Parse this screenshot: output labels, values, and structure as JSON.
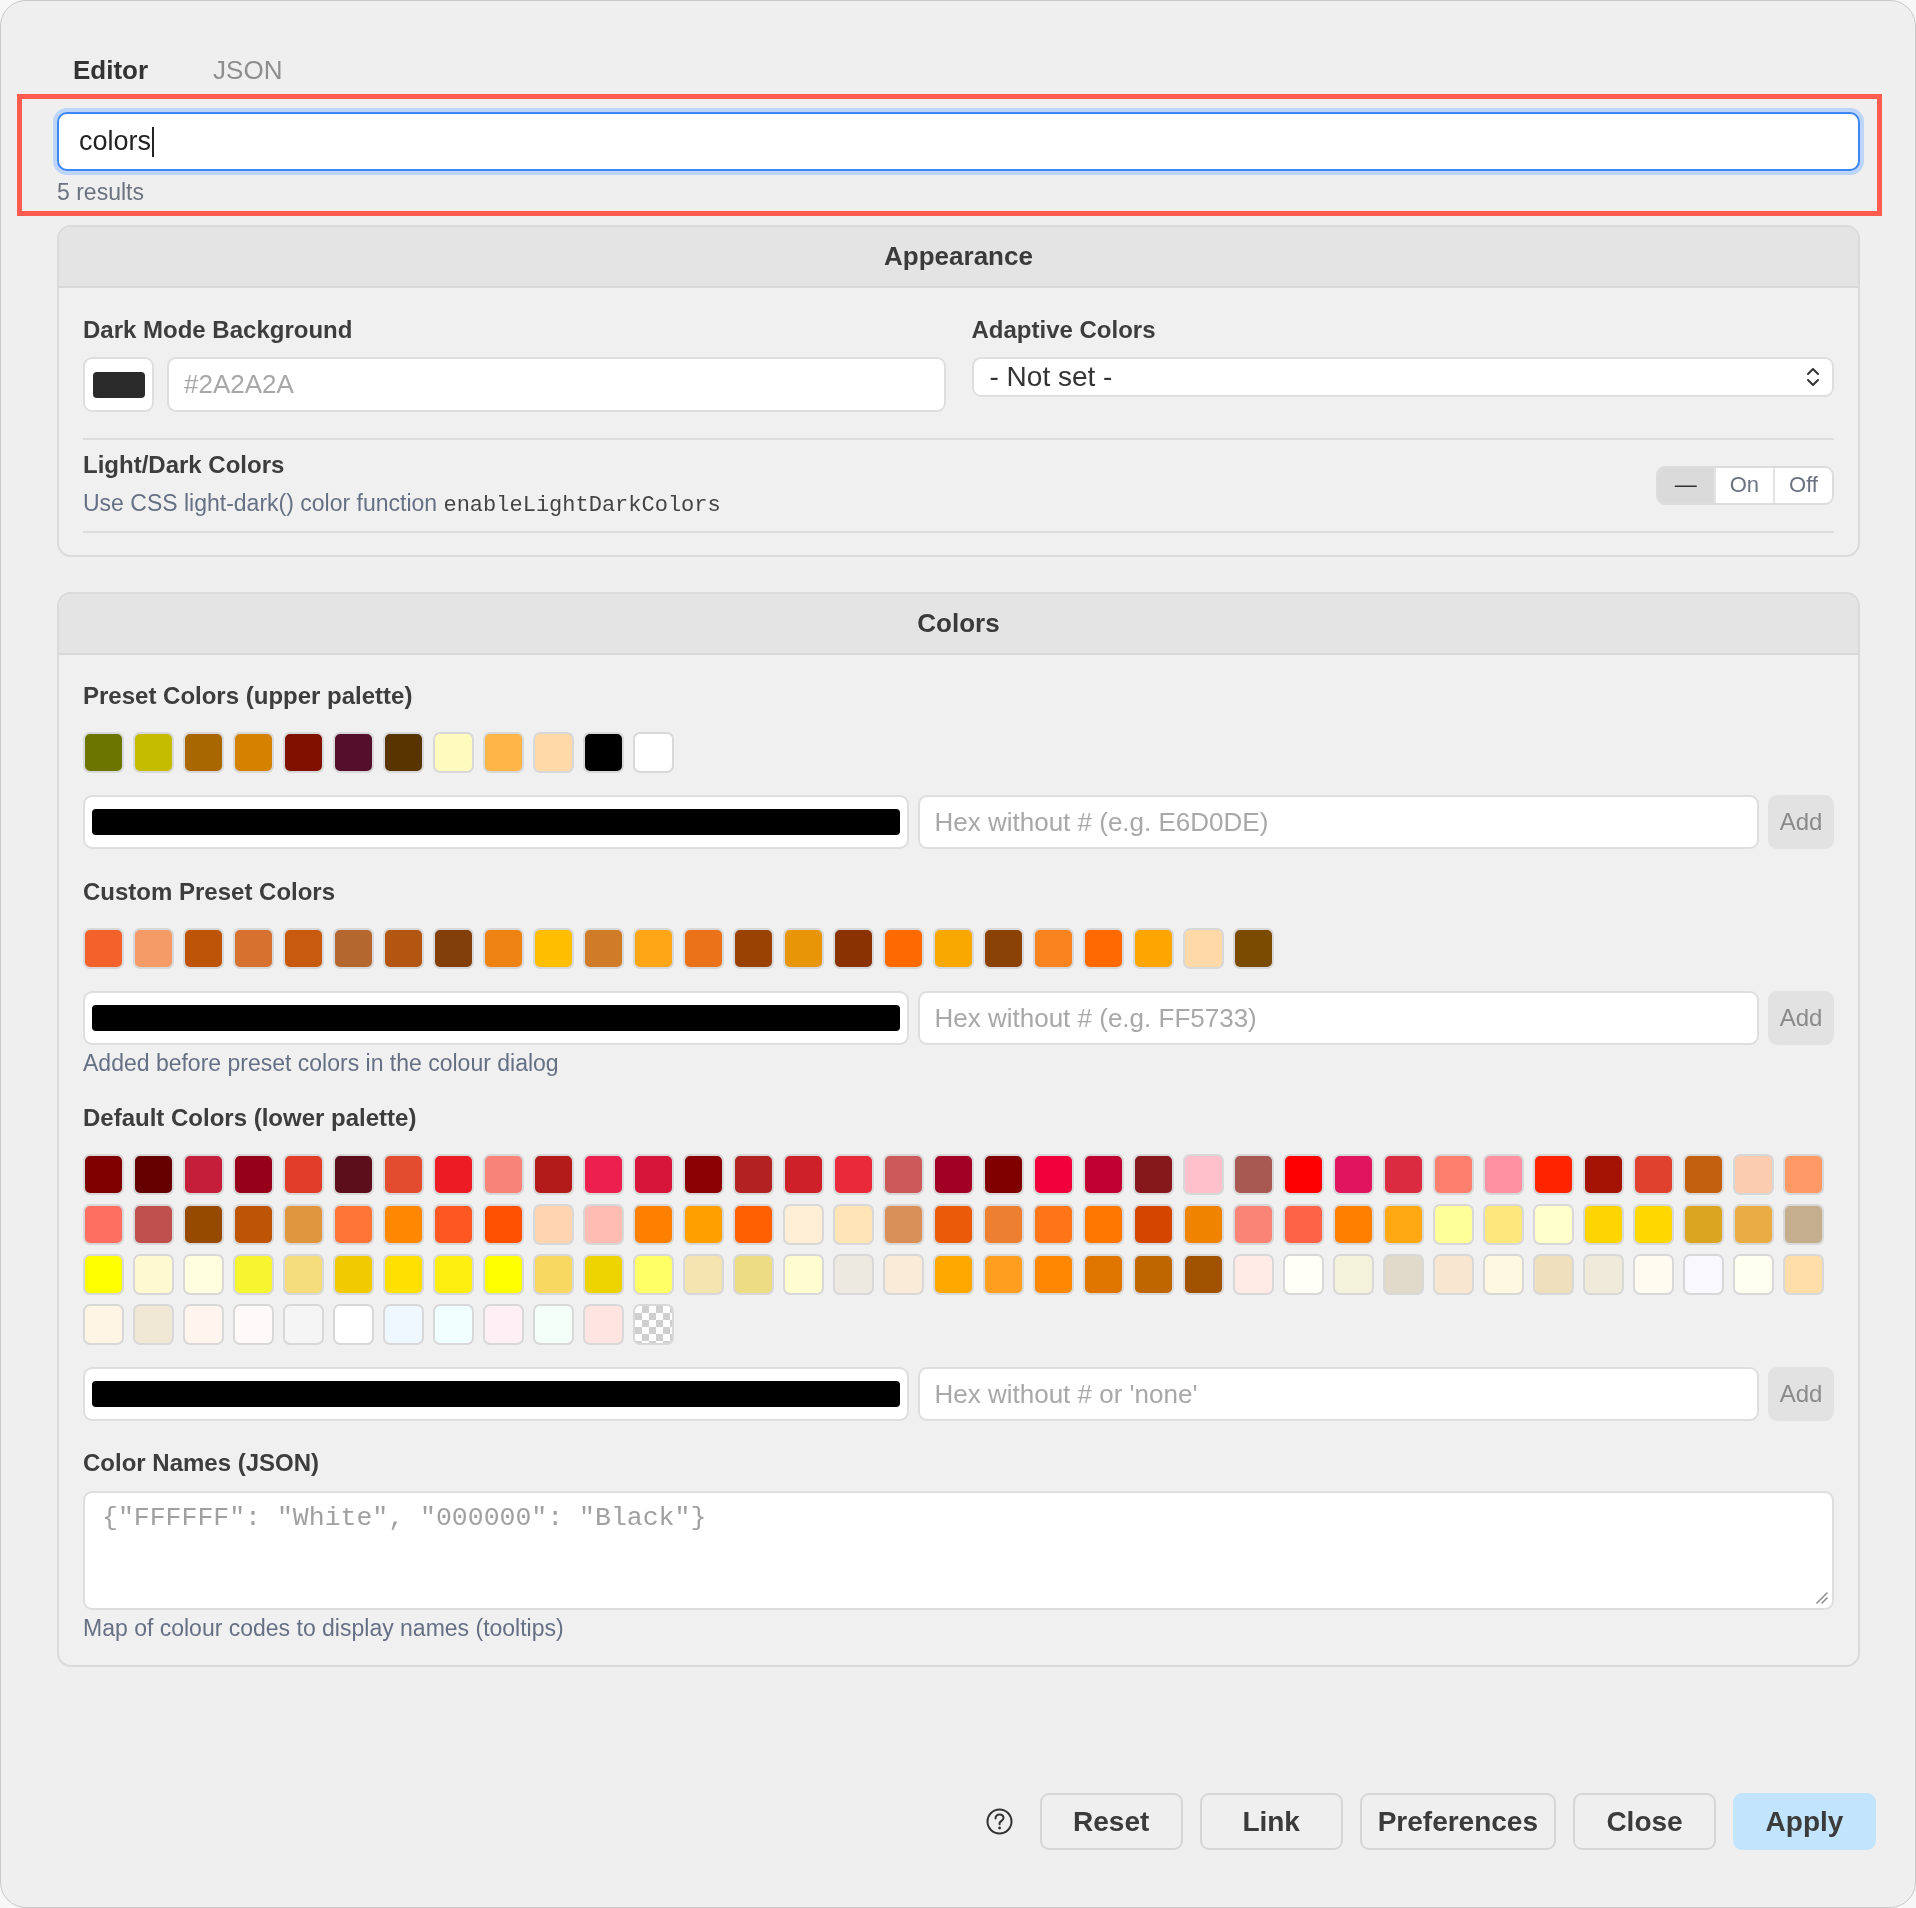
{
  "tabs": [
    {
      "label": "Editor",
      "selected": true
    },
    {
      "label": "JSON",
      "selected": false
    }
  ],
  "search": {
    "value": "colors",
    "focused": true,
    "highlighted": true,
    "result_count": "5 results"
  },
  "appearance": {
    "title": "Appearance",
    "dark_mode_background": {
      "label": "Dark Mode Background",
      "swatch": {
        "color": "#2a2a2a"
      },
      "placeholder": "#2A2A2A"
    },
    "adaptive_colors": {
      "label": "Adaptive Colors",
      "value": "- Not set -"
    },
    "light_dark_colors": {
      "label": "Light/Dark Colors",
      "description": "Use CSS light-dark() color function",
      "option_key": "enableLightDarkColors",
      "segments": [
        {
          "label": "—",
          "selected": true
        },
        {
          "label": "On",
          "selected": false
        },
        {
          "label": "Off",
          "selected": false
        }
      ]
    }
  },
  "colors": {
    "title": "Colors",
    "groups": [
      {
        "label": "Preset Colors (upper palette)",
        "swatches": [
          {
            "color": "#6b7500"
          },
          {
            "color": "#c5bc00"
          },
          {
            "color": "#a86700"
          },
          {
            "color": "#d48200"
          },
          {
            "color": "#801100"
          },
          {
            "color": "#54102a"
          },
          {
            "color": "#573400"
          },
          {
            "color": "#fffbbe"
          },
          {
            "color": "#ffb647"
          },
          {
            "color": "#ffd9a8"
          },
          {
            "color": "#000000"
          },
          {
            "color": "#ffffff"
          }
        ],
        "picker": {
          "color": "#000000"
        },
        "placeholder": "Hex without # (e.g. E6D0DE)",
        "add_label": "Add"
      },
      {
        "label": "Custom Preset Colors",
        "swatches": [
          {
            "color": "#f2622a"
          },
          {
            "color": "#f59b67"
          },
          {
            "color": "#be5408"
          },
          {
            "color": "#d7712f"
          },
          {
            "color": "#c85a10"
          },
          {
            "color": "#b4682f"
          },
          {
            "color": "#b25612"
          },
          {
            "color": "#833f09"
          },
          {
            "color": "#ee8314"
          },
          {
            "color": "#ffbf00"
          },
          {
            "color": "#cf7b27"
          },
          {
            "color": "#fea615"
          },
          {
            "color": "#ec721a"
          },
          {
            "color": "#9a4104"
          },
          {
            "color": "#e89608"
          },
          {
            "color": "#8a3202"
          },
          {
            "color": "#ff6a00"
          },
          {
            "color": "#f9a800"
          },
          {
            "color": "#8a4304"
          },
          {
            "color": "#f8831f"
          },
          {
            "color": "#ff6900"
          },
          {
            "color": "#fea600"
          },
          {
            "color": "#ffd9a8"
          },
          {
            "color": "#7a4b00"
          }
        ],
        "picker": {
          "color": "#000000"
        },
        "placeholder": "Hex without # (e.g. FF5733)",
        "add_label": "Add",
        "caption": "Added before preset colors in the colour dialog"
      },
      {
        "label": "Default Colors (lower palette)",
        "swatches": [
          {
            "kind": "solid",
            "color": "#800000"
          },
          {
            "kind": "solid",
            "color": "#660000"
          },
          {
            "kind": "solid",
            "color": "#c41e3a"
          },
          {
            "kind": "solid",
            "color": "#960018"
          },
          {
            "kind": "solid",
            "color": "#e23d28"
          },
          {
            "kind": "solid",
            "color": "#5c0e1a"
          },
          {
            "kind": "solid",
            "color": "#e34c2e"
          },
          {
            "kind": "solid",
            "color": "#ed1c24"
          },
          {
            "kind": "solid",
            "color": "#f88379"
          },
          {
            "kind": "solid",
            "color": "#b31b1b"
          },
          {
            "kind": "solid",
            "color": "#ed1f4f"
          },
          {
            "kind": "solid",
            "color": "#d7143a"
          },
          {
            "kind": "solid",
            "color": "#8b0000"
          },
          {
            "kind": "solid",
            "color": "#b22222"
          },
          {
            "kind": "solid",
            "color": "#ce2029"
          },
          {
            "kind": "solid",
            "color": "#ea2a3a"
          },
          {
            "kind": "solid",
            "color": "#cc5a5a"
          },
          {
            "kind": "solid",
            "color": "#a20025"
          },
          {
            "kind": "solid",
            "color": "#800000"
          },
          {
            "kind": "solid",
            "color": "#f2003c"
          },
          {
            "kind": "solid",
            "color": "#c00030"
          },
          {
            "kind": "solid",
            "color": "#86171a"
          },
          {
            "kind": "solid",
            "color": "#ffbfcb"
          },
          {
            "kind": "solid",
            "color": "#a85a52"
          },
          {
            "kind": "solid",
            "color": "#ff0000"
          },
          {
            "kind": "solid",
            "color": "#e0145f"
          },
          {
            "kind": "solid",
            "color": "#db2b40"
          },
          {
            "kind": "solid",
            "color": "#ff7f6e"
          },
          {
            "kind": "solid",
            "color": "#ff91a3"
          },
          {
            "kind": "solid",
            "color": "#ff2400"
          },
          {
            "kind": "solid",
            "color": "#a31202"
          },
          {
            "kind": "solid",
            "color": "#e0412f"
          },
          {
            "kind": "solid",
            "color": "#c3600f"
          },
          {
            "kind": "solid",
            "color": "#fbccae"
          },
          {
            "kind": "solid",
            "color": "#ff9966"
          },
          {
            "kind": "solid",
            "color": "#ff6f61"
          },
          {
            "kind": "solid",
            "color": "#c0504d"
          },
          {
            "kind": "solid",
            "color": "#954a00"
          },
          {
            "kind": "solid",
            "color": "#be5504"
          },
          {
            "kind": "solid",
            "color": "#e0963e"
          },
          {
            "kind": "solid",
            "color": "#ff7538"
          },
          {
            "kind": "solid",
            "color": "#ff8800"
          },
          {
            "kind": "solid",
            "color": "#ff5722"
          },
          {
            "kind": "solid",
            "color": "#ff4f00"
          },
          {
            "kind": "solid",
            "color": "#ffd4b0"
          },
          {
            "kind": "solid",
            "color": "#ffbcb3"
          },
          {
            "kind": "solid",
            "color": "#ff7f00"
          },
          {
            "kind": "solid",
            "color": "#ffa000"
          },
          {
            "kind": "solid",
            "color": "#ff5f00"
          },
          {
            "kind": "solid",
            "color": "#ffeed6"
          },
          {
            "kind": "solid",
            "color": "#ffe4b5"
          },
          {
            "kind": "solid",
            "color": "#d99058"
          },
          {
            "kind": "solid",
            "color": "#eb5a08"
          },
          {
            "kind": "solid",
            "color": "#ed7f31"
          },
          {
            "kind": "solid",
            "color": "#ff7518"
          },
          {
            "kind": "solid",
            "color": "#ff7700"
          },
          {
            "kind": "solid",
            "color": "#d44500"
          },
          {
            "kind": "solid",
            "color": "#f08300"
          },
          {
            "kind": "solid",
            "color": "#fa8476"
          },
          {
            "kind": "solid",
            "color": "#ff6347"
          },
          {
            "kind": "solid",
            "color": "#ff8000"
          },
          {
            "kind": "solid",
            "color": "#ffa812"
          },
          {
            "kind": "solid",
            "color": "#ffff99"
          },
          {
            "kind": "solid",
            "color": "#fee77b"
          },
          {
            "kind": "solid",
            "color": "#ffffcc"
          },
          {
            "kind": "solid",
            "color": "#ffd500"
          },
          {
            "kind": "solid",
            "color": "#ffd800"
          },
          {
            "kind": "solid",
            "color": "#daa520"
          },
          {
            "kind": "solid",
            "color": "#e9ad44"
          },
          {
            "kind": "solid",
            "color": "#c5ae8e"
          },
          {
            "kind": "solid",
            "color": "#ffff00"
          },
          {
            "kind": "solid",
            "color": "#fff9d1"
          },
          {
            "kind": "solid",
            "color": "#ffffe0"
          },
          {
            "kind": "solid",
            "color": "#f7f52f"
          },
          {
            "kind": "solid",
            "color": "#f5dd7c"
          },
          {
            "kind": "solid",
            "color": "#f1ca00"
          },
          {
            "kind": "solid",
            "color": "#ffe000"
          },
          {
            "kind": "solid",
            "color": "#ffef10"
          },
          {
            "kind": "solid",
            "color": "#ffff00"
          },
          {
            "kind": "solid",
            "color": "#f8d860"
          },
          {
            "kind": "solid",
            "color": "#edd300"
          },
          {
            "kind": "solid",
            "color": "#ffff66"
          },
          {
            "kind": "solid",
            "color": "#f3e4b0"
          },
          {
            "kind": "solid",
            "color": "#eddc82"
          },
          {
            "kind": "solid",
            "color": "#fffdd0"
          },
          {
            "kind": "solid",
            "color": "#ede8e0"
          },
          {
            "kind": "solid",
            "color": "#faebd8"
          },
          {
            "kind": "solid",
            "color": "#ffa800"
          },
          {
            "kind": "solid",
            "color": "#ff9e1f"
          },
          {
            "kind": "solid",
            "color": "#ff8800"
          },
          {
            "kind": "solid",
            "color": "#e07600"
          },
          {
            "kind": "solid",
            "color": "#bf6600"
          },
          {
            "kind": "solid",
            "color": "#a05200"
          },
          {
            "kind": "solid",
            "color": "#ffeae6"
          },
          {
            "kind": "solid",
            "color": "#fffff7"
          },
          {
            "kind": "solid",
            "color": "#f5f2dc"
          },
          {
            "kind": "solid",
            "color": "#e1daca"
          },
          {
            "kind": "solid",
            "color": "#f8e6d0"
          },
          {
            "kind": "solid",
            "color": "#fff8e0"
          },
          {
            "kind": "solid",
            "color": "#efdfbc"
          },
          {
            "kind": "solid",
            "color": "#f0eada"
          },
          {
            "kind": "solid",
            "color": "#fffbf0"
          },
          {
            "kind": "solid",
            "color": "#f8f8fe"
          },
          {
            "kind": "solid",
            "color": "#fffff0"
          },
          {
            "kind": "solid",
            "color": "#ffdeaa"
          },
          {
            "kind": "solid",
            "color": "#fff5e5"
          },
          {
            "kind": "solid",
            "color": "#f0e8d5"
          },
          {
            "kind": "solid",
            "color": "#fff4ee"
          },
          {
            "kind": "solid",
            "color": "#fffafa"
          },
          {
            "kind": "solid",
            "color": "#f5f5f5"
          },
          {
            "kind": "solid",
            "color": "#ffffff"
          },
          {
            "kind": "solid",
            "color": "#f0f8ff"
          },
          {
            "kind": "solid",
            "color": "#f0ffff"
          },
          {
            "kind": "solid",
            "color": "#fff0f5"
          },
          {
            "kind": "solid",
            "color": "#f5fffa"
          },
          {
            "kind": "solid",
            "color": "#ffe4e1"
          },
          {
            "kind": "transparent"
          }
        ],
        "picker": {
          "color": "#000000"
        },
        "placeholder": "Hex without # or 'none'",
        "add_label": "Add"
      }
    ],
    "color_names": {
      "label": "Color Names (JSON)",
      "placeholder": "{\"FFFFFF\": \"White\", \"000000\": \"Black\"}",
      "caption": "Map of colour codes to display names (tooltips)"
    }
  },
  "footer": {
    "buttons": [
      {
        "label": "Reset",
        "primary": false
      },
      {
        "label": "Link",
        "primary": false
      },
      {
        "label": "Preferences",
        "primary": false
      },
      {
        "label": "Close",
        "primary": false
      },
      {
        "label": "Apply",
        "primary": true
      }
    ]
  }
}
